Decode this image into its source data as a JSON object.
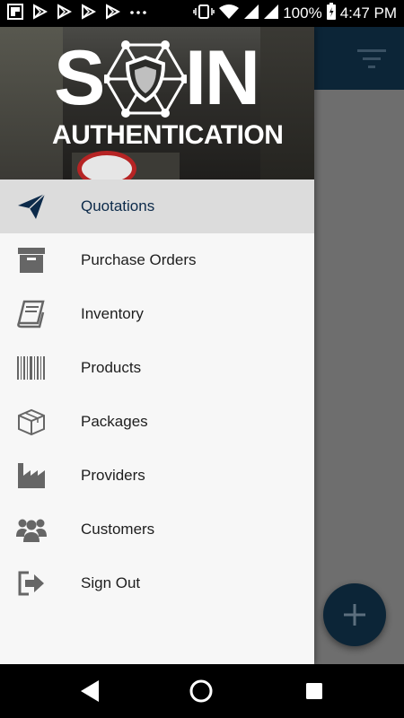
{
  "status_bar": {
    "battery_percent": "100%",
    "time": "4:47 PM",
    "left_icons": [
      "flipboard-icon",
      "play-store-icon",
      "play-store-icon",
      "play-store-icon",
      "play-store-icon",
      "more-dots-icon"
    ],
    "right_icons": [
      "vibrate-icon",
      "wifi-icon",
      "signal-icon",
      "signal-icon",
      "battery-icon"
    ]
  },
  "drawer": {
    "header": {
      "logo_title_left": "S",
      "logo_title_right": "IN",
      "logo_subtitle": "AUTHENTICATION"
    },
    "items": [
      {
        "label": "Quotations",
        "icon": "paper-plane-icon",
        "active": true
      },
      {
        "label": "Purchase Orders",
        "icon": "archive-box-icon",
        "active": false
      },
      {
        "label": "Inventory",
        "icon": "book-icon",
        "active": false
      },
      {
        "label": "Products",
        "icon": "barcode-icon",
        "active": false
      },
      {
        "label": "Packages",
        "icon": "package-icon",
        "active": false
      },
      {
        "label": "Providers",
        "icon": "factory-icon",
        "active": false
      },
      {
        "label": "Customers",
        "icon": "users-icon",
        "active": false
      },
      {
        "label": "Sign Out",
        "icon": "sign-out-icon",
        "active": false
      }
    ]
  },
  "app_toolbar": {
    "icon": "filter-icon"
  },
  "fab": {
    "icon": "plus-icon"
  },
  "colors": {
    "primary_dark": "#0c2537",
    "active_item_bg": "#dcdcdc",
    "active_label": "#0c2a4a",
    "icon_gray": "#666666",
    "scrim": "#6e6e6e"
  },
  "nav_bar": {
    "buttons": [
      "back-icon",
      "home-icon",
      "recents-icon"
    ]
  }
}
